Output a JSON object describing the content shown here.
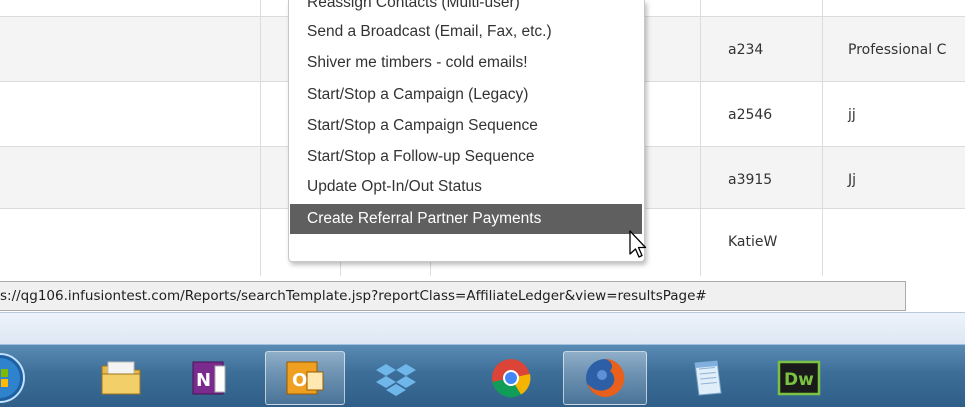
{
  "menu": {
    "items": [
      {
        "label": "Reassign Contacts (Multi-user)",
        "active": false
      },
      {
        "label": "Send a Broadcast (Email, Fax, etc.)",
        "active": false
      },
      {
        "label": "Shiver me timbers - cold emails!",
        "active": false
      },
      {
        "label": "Start/Stop a Campaign (Legacy)",
        "active": false
      },
      {
        "label": "Start/Stop a Campaign Sequence",
        "active": false
      },
      {
        "label": "Start/Stop a Follow-up Sequence",
        "active": false
      },
      {
        "label": "Update Opt-In/Out Status",
        "active": false
      },
      {
        "label": "Create Referral Partner Payments",
        "active": true
      }
    ]
  },
  "table": {
    "rows": [
      {
        "code": "a234",
        "name": "Professional C"
      },
      {
        "code": "a2546",
        "name": "jj"
      },
      {
        "code": "a3915",
        "name": "Jj"
      },
      {
        "code": "KatieW",
        "name": ""
      }
    ]
  },
  "statusbar": {
    "url": "s://qg106.infusiontest.com/Reports/searchTemplate.jsp?reportClass=AffiliateLedger&view=resultsPage#"
  },
  "taskbar": {
    "items": [
      {
        "icon": "windows-start-icon"
      },
      {
        "icon": "file-explorer-icon"
      },
      {
        "icon": "onenote-icon"
      },
      {
        "icon": "outlook-icon"
      },
      {
        "icon": "dropbox-icon"
      },
      {
        "icon": "chrome-icon"
      },
      {
        "icon": "firefox-icon"
      },
      {
        "icon": "notepad-icon"
      },
      {
        "icon": "dreamweaver-icon",
        "label": "Dw"
      }
    ]
  },
  "colors": {
    "menu_highlight": "#5f5f5f",
    "taskbar": "#3d6e98",
    "dreamweaver": "#1a1a1a"
  }
}
